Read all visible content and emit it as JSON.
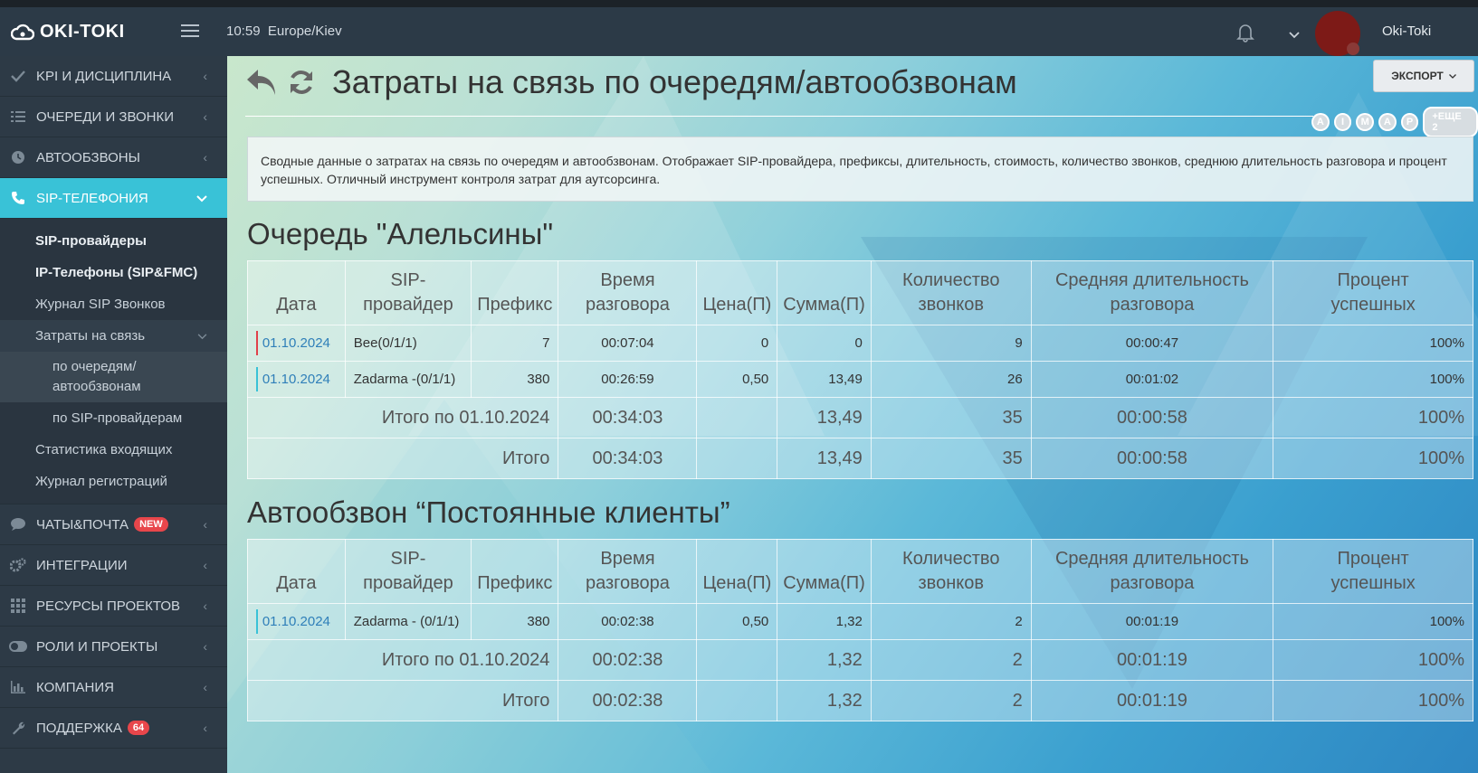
{
  "header": {
    "logo_text": "OKI-TOKI",
    "time": "10:59",
    "timezone": "Europe/Kiev",
    "username": "Oki-Toki"
  },
  "sidebar": {
    "items": [
      {
        "label": "KPI И ДИСЦИПЛИНА",
        "icon": "check-icon"
      },
      {
        "label": "ОЧЕРЕДИ И ЗВОНКИ",
        "icon": "list-icon"
      },
      {
        "label": "АВТООБЗВОНЫ",
        "icon": "clock-icon"
      },
      {
        "label": "SIP-ТЕЛЕФОНИЯ",
        "icon": "phone-icon"
      },
      {
        "label": "ЧАТЫ&ПОЧТА",
        "icon": "chat-icon",
        "badge": "NEW"
      },
      {
        "label": "ИНТЕГРАЦИИ",
        "icon": "gears-icon"
      },
      {
        "label": "РЕСУРСЫ ПРОЕКТОВ",
        "icon": "grid-icon"
      },
      {
        "label": "РОЛИ И ПРОЕКТЫ",
        "icon": "toggle-icon"
      },
      {
        "label": "КОМПАНИЯ",
        "icon": "bar-chart-icon"
      },
      {
        "label": "ПОДДЕРЖКА",
        "icon": "wrench-icon",
        "badge": "64"
      }
    ],
    "sub": {
      "sip_providers": "SIP-провайдеры",
      "ip_phones": "IP-Телефоны (SIP&FMC)",
      "sip_log": "Журнал SIP Звонков",
      "costs": "Затраты на связь",
      "by_queues": "по очередям/ автообзвонам",
      "by_providers": "по SIP-провайдерам",
      "incoming_stats": "Статистика входящих",
      "reg_log": "Журнал регистраций"
    }
  },
  "page": {
    "title": "Затраты на связь по очередям/автообзвонам",
    "export_label": "ЭКСПОРТ",
    "letters": [
      "A",
      "I",
      "M",
      "A",
      "P"
    ],
    "more_label": "+ЕЩЕ 2",
    "description": "Сводные данные о затратах на связь по очередям и автообзвонам. Отображает SIP-провайдера, префиксы, длительность, стоимость, количество звонков, среднюю длительность разговора и процент успешных. Отличный инструмент контроля затрат для аутсорсинга."
  },
  "columns": {
    "date": "Дата",
    "provider_1": "SIP-",
    "provider_2": "провайдер",
    "prefix": "Префикс",
    "duration_1": "Время",
    "duration_2": "разговора",
    "price": "Цена(П)",
    "sum": "Сумма(П)",
    "count_1": "Количество",
    "count_2": "звонков",
    "avg_1": "Средняя длительность",
    "avg_2": "разговора",
    "pct_1": "Процент",
    "pct_2": "успешных"
  },
  "section1": {
    "title": "Очередь \"Алельсины\"",
    "rows": [
      {
        "date": "01.10.2024",
        "provider": "Bee(0/1/1)",
        "prefix": "7",
        "duration": "00:07:04",
        "price": "0",
        "sum": "0",
        "count": "9",
        "avg": "00:00:47",
        "pct": "100%"
      },
      {
        "date": "01.10.2024",
        "provider": "Zadarma -(0/1/1)",
        "prefix": "380",
        "duration": "00:26:59",
        "price": "0,50",
        "sum": "13,49",
        "count": "26",
        "avg": "00:01:02",
        "pct": "100%"
      }
    ],
    "subtotal": {
      "label": "Итого по 01.10.2024",
      "duration": "00:34:03",
      "sum": "13,49",
      "count": "35",
      "avg": "00:00:58",
      "pct": "100%"
    },
    "total": {
      "label": "Итого",
      "duration": "00:34:03",
      "sum": "13,49",
      "count": "35",
      "avg": "00:00:58",
      "pct": "100%"
    }
  },
  "section2": {
    "title": "Автообзвон “Постоянные клиенты”",
    "rows": [
      {
        "date": "01.10.2024",
        "provider": "Zadarma - (0/1/1)",
        "prefix": "380",
        "duration": "00:02:38",
        "price": "0,50",
        "sum": "1,32",
        "count": "2",
        "avg": "00:01:19",
        "pct": "100%"
      }
    ],
    "subtotal": {
      "label": "Итого по 01.10.2024",
      "duration": "00:02:38",
      "sum": "1,32",
      "count": "2",
      "avg": "00:01:19",
      "pct": "100%"
    },
    "total": {
      "label": "Итого",
      "duration": "00:02:38",
      "sum": "1,32",
      "count": "2",
      "avg": "00:01:19",
      "pct": "100%"
    }
  }
}
